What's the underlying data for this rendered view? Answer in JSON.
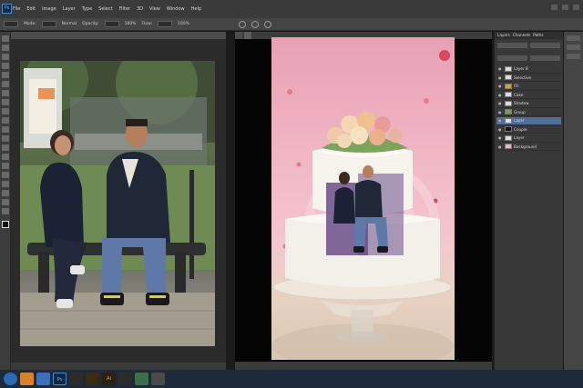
{
  "menubar": {
    "items": [
      "File",
      "Edit",
      "Image",
      "Layer",
      "Type",
      "Select",
      "Filter",
      "3D",
      "View",
      "Window",
      "Help"
    ]
  },
  "options": {
    "items": [
      "Mode:",
      "Normal",
      "Opacity:",
      "100%",
      "Flow:",
      "100%"
    ]
  },
  "doc1": {
    "tab": "",
    "status": ""
  },
  "doc2": {
    "tabs": [
      "",
      ""
    ],
    "status": [
      "",
      ""
    ]
  },
  "layers": {
    "tabs": [
      "Layers",
      "Channels",
      "Paths"
    ],
    "items": [
      {
        "name": "Layer 8",
        "selected": false
      },
      {
        "name": "Selective",
        "selected": false
      },
      {
        "name": "Fill",
        "selected": false
      },
      {
        "name": "Cake",
        "selected": false
      },
      {
        "name": "Shadow",
        "selected": false
      },
      {
        "name": "Group",
        "selected": false
      },
      {
        "name": "Layer",
        "selected": true
      },
      {
        "name": "Couple",
        "selected": false
      },
      {
        "name": "Layer",
        "selected": false
      },
      {
        "name": "Background",
        "selected": false
      }
    ]
  },
  "taskbar": {
    "items": [
      "",
      "",
      "Ps",
      "",
      "",
      "Ai",
      "",
      "",
      "",
      ""
    ]
  },
  "colors": {
    "accent": "#4e6f9a",
    "ps_blue": "#0c2a46"
  }
}
